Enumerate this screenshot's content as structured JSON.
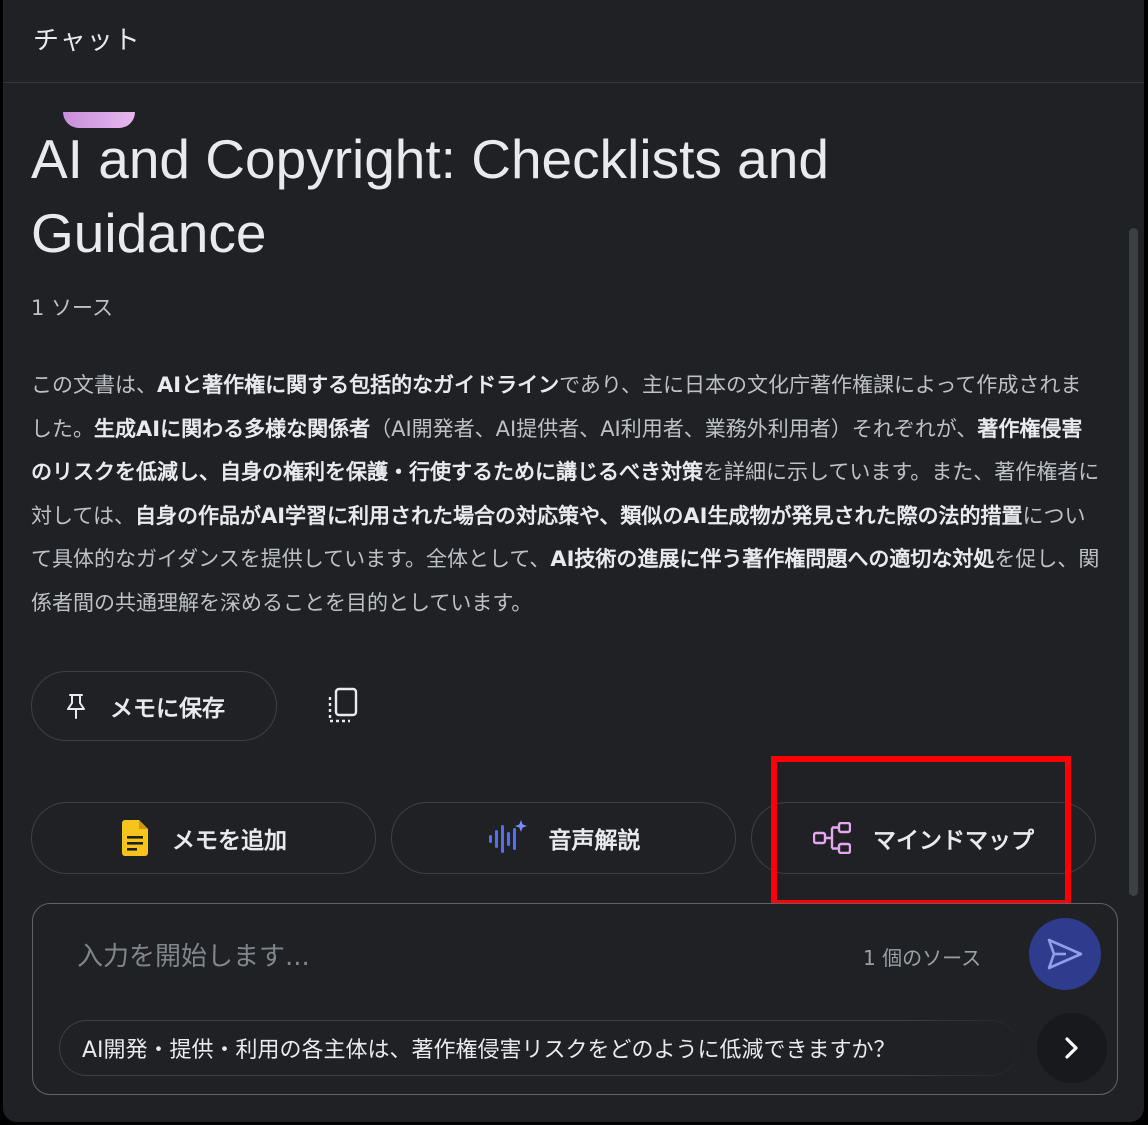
{
  "header": {
    "title": "チャット"
  },
  "notebook": {
    "title": "AI and Copyright: Checklists and Guidance",
    "source_count": "1 ソース",
    "summary": [
      {
        "t": "この文書は、",
        "b": false
      },
      {
        "t": "AIと著作権に関する包括的なガイドライン",
        "b": true
      },
      {
        "t": "であり、主に日本の文化庁著作権課によって作成されました。",
        "b": false
      },
      {
        "t": "生成AIに関わる多様な関係者",
        "b": true
      },
      {
        "t": "（AI開発者、AI提供者、AI利用者、業務外利用者）それぞれが、",
        "b": false
      },
      {
        "t": "著作権侵害のリスクを低減し、自身の権利を保護・行使するために講じるべき対策",
        "b": true
      },
      {
        "t": "を詳細に示しています。また、著作権者に対しては、",
        "b": false
      },
      {
        "t": "自身の作品がAI学習に利用された場合の対応策や、類似のAI生成物が発見された際の法的措置",
        "b": true
      },
      {
        "t": "について具体的なガイダンスを提供しています。全体として、",
        "b": false
      },
      {
        "t": "AI技術の進展に伴う著作権問題への適切な対処",
        "b": true
      },
      {
        "t": "を促し、関係者間の共通理解を深めることを目的としています。",
        "b": false
      }
    ]
  },
  "actions": {
    "save_note": "メモに保存",
    "add_note": "メモを追加",
    "audio_overview": "音声解説",
    "mind_map": "マインドマップ"
  },
  "composer": {
    "placeholder": "入力を開始します...",
    "source_label": "1 個のソース",
    "suggestion": "AI開発・提供・利用の各主体は、著作権侵害リスクをどのように低減できますか？"
  },
  "colors": {
    "accent_send": "#2f3c8e",
    "note_icon": "#f9c31e",
    "audio_icon": "#5b6cf0",
    "mindmap_icon": "#e6a6f0",
    "highlight": "#ff0000"
  }
}
